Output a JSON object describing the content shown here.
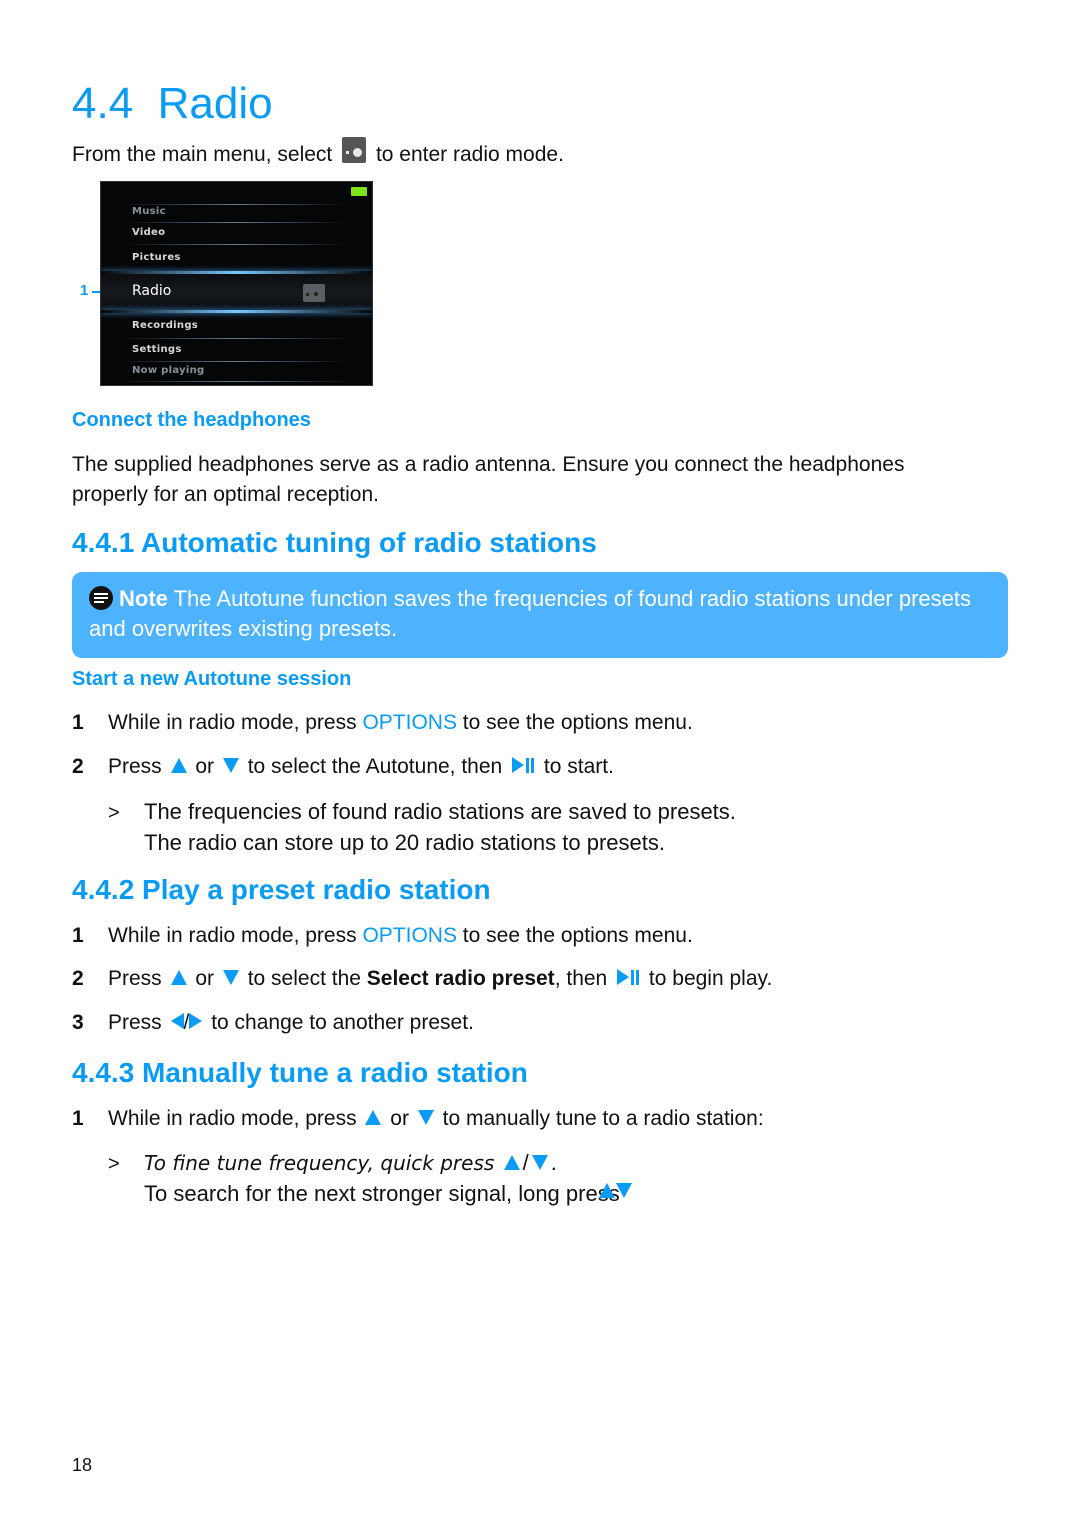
{
  "page": {
    "title": "4.4  Radio",
    "intro_before": "From the main menu, select",
    "intro_icon": "radio-icon",
    "intro_after": "to enter radio mode.",
    "page_number": "18"
  },
  "device_screen": {
    "callout_number": "1",
    "battery_color": "#7ee51b",
    "menu_items": [
      {
        "label": "Music",
        "selected": false,
        "dim": true
      },
      {
        "label": "Video",
        "selected": false,
        "dim": false
      },
      {
        "label": "Pictures",
        "selected": false,
        "dim": false
      },
      {
        "label": "Radio",
        "selected": true,
        "dim": false
      },
      {
        "label": "Recordings",
        "selected": false,
        "dim": false
      },
      {
        "label": "Settings",
        "selected": false,
        "dim": false
      },
      {
        "label": "Now playing",
        "selected": false,
        "dim": true
      }
    ]
  },
  "connect": {
    "heading": "Connect the headphones",
    "text": "The supplied headphones serve as a radio antenna. Ensure you connect the headphones properly for an optimal reception."
  },
  "section_441": {
    "heading": "4.4.1 Automatic tuning of radio stations",
    "note_label": "Note",
    "note_text": " The Autotune function saves the frequencies of found radio stations under presets and overwrites existing presets.",
    "subheading": "Start a new Autotune session",
    "step1": {
      "num": "1",
      "before": "While in radio mode, press ",
      "key": "OPTIONS",
      "after": " to see the options menu."
    },
    "step2": {
      "num": "2",
      "a": "Press ",
      "b": " or ",
      "c": " to select the Autotune, then ",
      "d": " to start."
    },
    "result_marker": ">",
    "result_line1": "The frequencies of found radio stations are saved to presets.",
    "result_line2": "The radio can store up to 20 radio stations to presets."
  },
  "section_442": {
    "heading": "4.4.2 Play a preset radio station",
    "step1": {
      "num": "1",
      "before": "While in radio mode, press ",
      "key": "OPTIONS",
      "after": " to see the options menu."
    },
    "step2": {
      "num": "2",
      "a": "Press ",
      "b": " or ",
      "c": " to select the ",
      "bold": "Select radio preset",
      "d": ", then ",
      "e": " to begin play."
    },
    "step3": {
      "num": "3",
      "a": "Press ",
      "b": "/",
      "c": " to change to another preset."
    }
  },
  "section_443": {
    "heading": "4.4.3 Manually tune a radio station",
    "step1": {
      "num": "1",
      "a": "While in radio mode, press ",
      "b": " or ",
      "c": " to manually tune to a radio station:"
    },
    "result_marker": ">",
    "result_line1_a": "To fine tune frequency, quick press ",
    "result_line1_b": "/",
    "result_line1_c": ".",
    "result_line2": "To search for the next stronger signal, long press"
  }
}
